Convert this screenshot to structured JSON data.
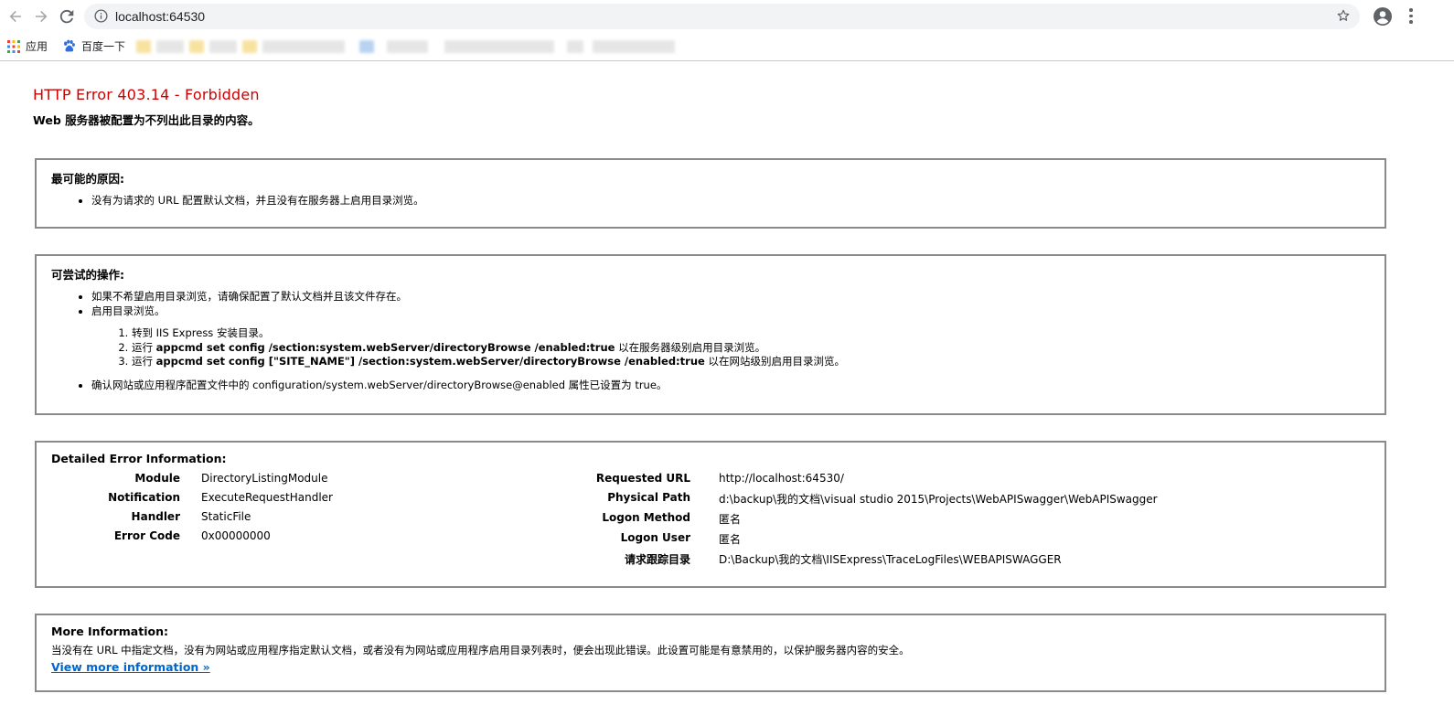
{
  "browser": {
    "url": "localhost:64530",
    "bookmarks": [
      {
        "label": "应用",
        "icon": "apps-grid-icon"
      },
      {
        "label": "百度一下",
        "icon": "baidu-paw-icon"
      }
    ]
  },
  "page": {
    "title": "HTTP Error 403.14 - Forbidden",
    "subtitle": "Web 服务器被配置为不列出此目录的内容。",
    "cause": {
      "heading": "最可能的原因:",
      "items": [
        "没有为请求的 URL 配置默认文档，并且没有在服务器上启用目录浏览。"
      ]
    },
    "actions": {
      "heading": "可尝试的操作:",
      "item1": "如果不希望启用目录浏览，请确保配置了默认文档并且该文件存在。",
      "item2": "启用目录浏览。",
      "steps": [
        {
          "pre": "转到 IIS Express 安装目录。",
          "cmd": "",
          "post": ""
        },
        {
          "pre": "运行 ",
          "cmd": "appcmd set config /section:system.webServer/directoryBrowse /enabled:true",
          "post": " 以在服务器级别启用目录浏览。"
        },
        {
          "pre": "运行 ",
          "cmd": "appcmd set config [\"SITE_NAME\"] /section:system.webServer/directoryBrowse /enabled:true",
          "post": " 以在网站级别启用目录浏览。"
        }
      ],
      "item3": "确认网站或应用程序配置文件中的 configuration/system.webServer/directoryBrowse@enabled 属性已设置为 true。"
    },
    "details": {
      "heading": "Detailed Error Information:",
      "left": [
        {
          "label": "Module",
          "value": "DirectoryListingModule"
        },
        {
          "label": "Notification",
          "value": "ExecuteRequestHandler"
        },
        {
          "label": "Handler",
          "value": "StaticFile"
        },
        {
          "label": "Error Code",
          "value": "0x00000000"
        }
      ],
      "right": [
        {
          "label": "Requested URL",
          "value": "http://localhost:64530/"
        },
        {
          "label": "Physical Path",
          "value": "d:\\backup\\我的文档\\visual studio 2015\\Projects\\WebAPISwagger\\WebAPISwagger"
        },
        {
          "label": "Logon Method",
          "value": "匿名"
        },
        {
          "label": "Logon User",
          "value": "匿名"
        },
        {
          "label": "请求跟踪目录",
          "value": "D:\\Backup\\我的文档\\IISExpress\\TraceLogFiles\\WEBAPISWAGGER"
        }
      ]
    },
    "more": {
      "heading": "More Information:",
      "text": "当没有在 URL 中指定文档，没有为网站或应用程序指定默认文档，或者没有为网站或应用程序启用目录列表时，便会出现此错误。此设置可能是有意禁用的，以保护服务器内容的安全。",
      "link": "View more information »"
    }
  }
}
